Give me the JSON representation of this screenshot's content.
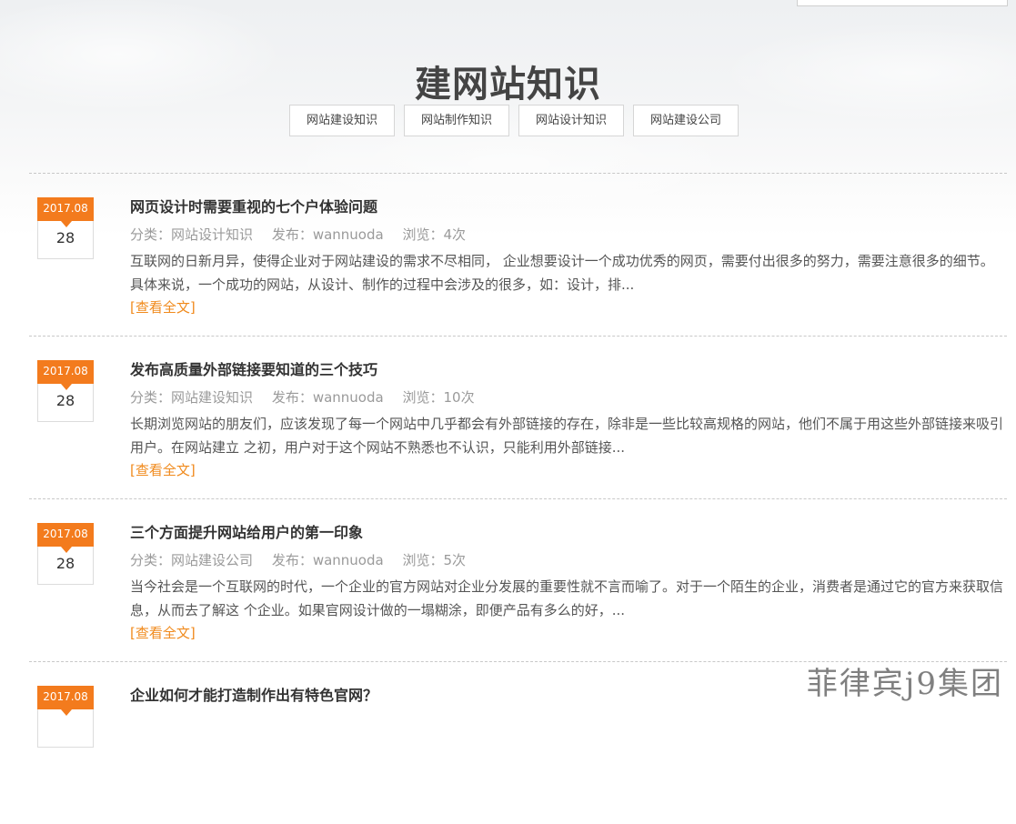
{
  "page": {
    "title": "建网站知识"
  },
  "categories": [
    "网站建设知识",
    "网站制作知识",
    "网站设计知识",
    "网站建设公司"
  ],
  "labels": {
    "category_prefix": "分类：",
    "publish_prefix": "发布：",
    "views_prefix": "浏览：",
    "read_more": "[查看全文]"
  },
  "articles": [
    {
      "date_month": "2017.08",
      "date_day": "28",
      "title": "网页设计时需要重视的七个户体验问题",
      "category": "网站设计知识",
      "author": "wannuoda",
      "views": "4次",
      "summary": "互联网的日新月异，使得企业对于网站建设的需求不尽相同， 企业想要设计一个成功优秀的网页，需要付出很多的努力，需要注意很多的细节。具体来说，一个成功的网站，从设计、制作的过程中会涉及的很多，如：设计，排..."
    },
    {
      "date_month": "2017.08",
      "date_day": "28",
      "title": "发布高质量外部链接要知道的三个技巧",
      "category": "网站建设知识",
      "author": "wannuoda",
      "views": "10次",
      "summary": "长期浏览网站的朋友们，应该发现了每一个网站中几乎都会有外部链接的存在，除非是一些比较高规格的网站，他们不属于用这些外部链接来吸引用户。在网站建立 之初，用户对于这个网站不熟悉也不认识，只能利用外部链接..."
    },
    {
      "date_month": "2017.08",
      "date_day": "28",
      "title": "三个方面提升网站给用户的第一印象",
      "category": "网站建设公司",
      "author": "wannuoda",
      "views": "5次",
      "summary": "当今社会是一个互联网的时代，一个企业的官方网站对企业分发展的重要性就不言而喻了。对于一个陌生的企业，消费者是通过它的官方来获取信息，从而去了解这 个企业。如果官网设计做的一塌糊涂，即便产品有多么的好，..."
    },
    {
      "date_month": "2017.08",
      "date_day": "",
      "title": "企业如何才能打造制作出有特色官网？",
      "category": "",
      "author": "",
      "views": "",
      "summary": ""
    }
  ],
  "watermark": "菲律宾j9集团",
  "colors": {
    "accent": "#f37b1d",
    "link": "#f08a1c"
  }
}
